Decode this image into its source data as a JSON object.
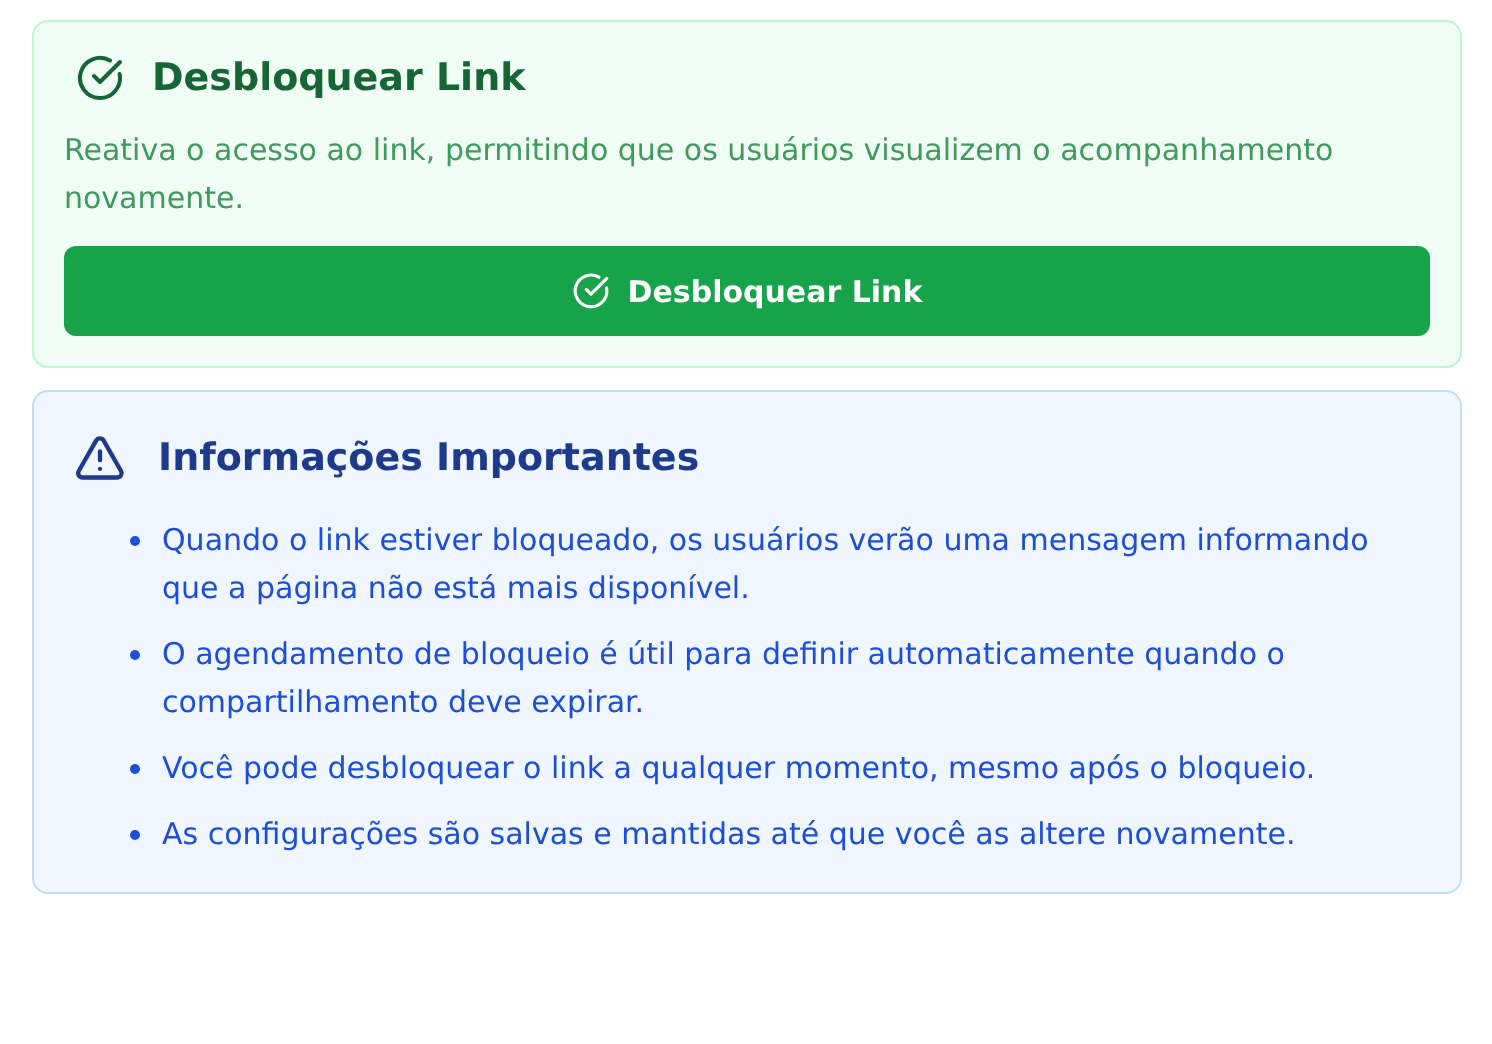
{
  "unlock_card": {
    "title": "Desbloquear Link",
    "description": "Reativa o acesso ao link, permitindo que os usuários visualizem o acompanhamento novamente.",
    "button": "Desbloquear Link"
  },
  "info_card": {
    "title": "Informações Importantes",
    "items": [
      "Quando o link estiver bloqueado, os usuários verão uma mensagem informando que a página não está mais disponível.",
      "O agendamento de bloqueio é útil para definir automaticamente quando o compartilhamento deve expirar.",
      "Você pode desbloquear o link a qualquer momento, mesmo após o bloqueio.",
      "As configurações são salvas e mantidas até que você as altere novamente."
    ]
  }
}
